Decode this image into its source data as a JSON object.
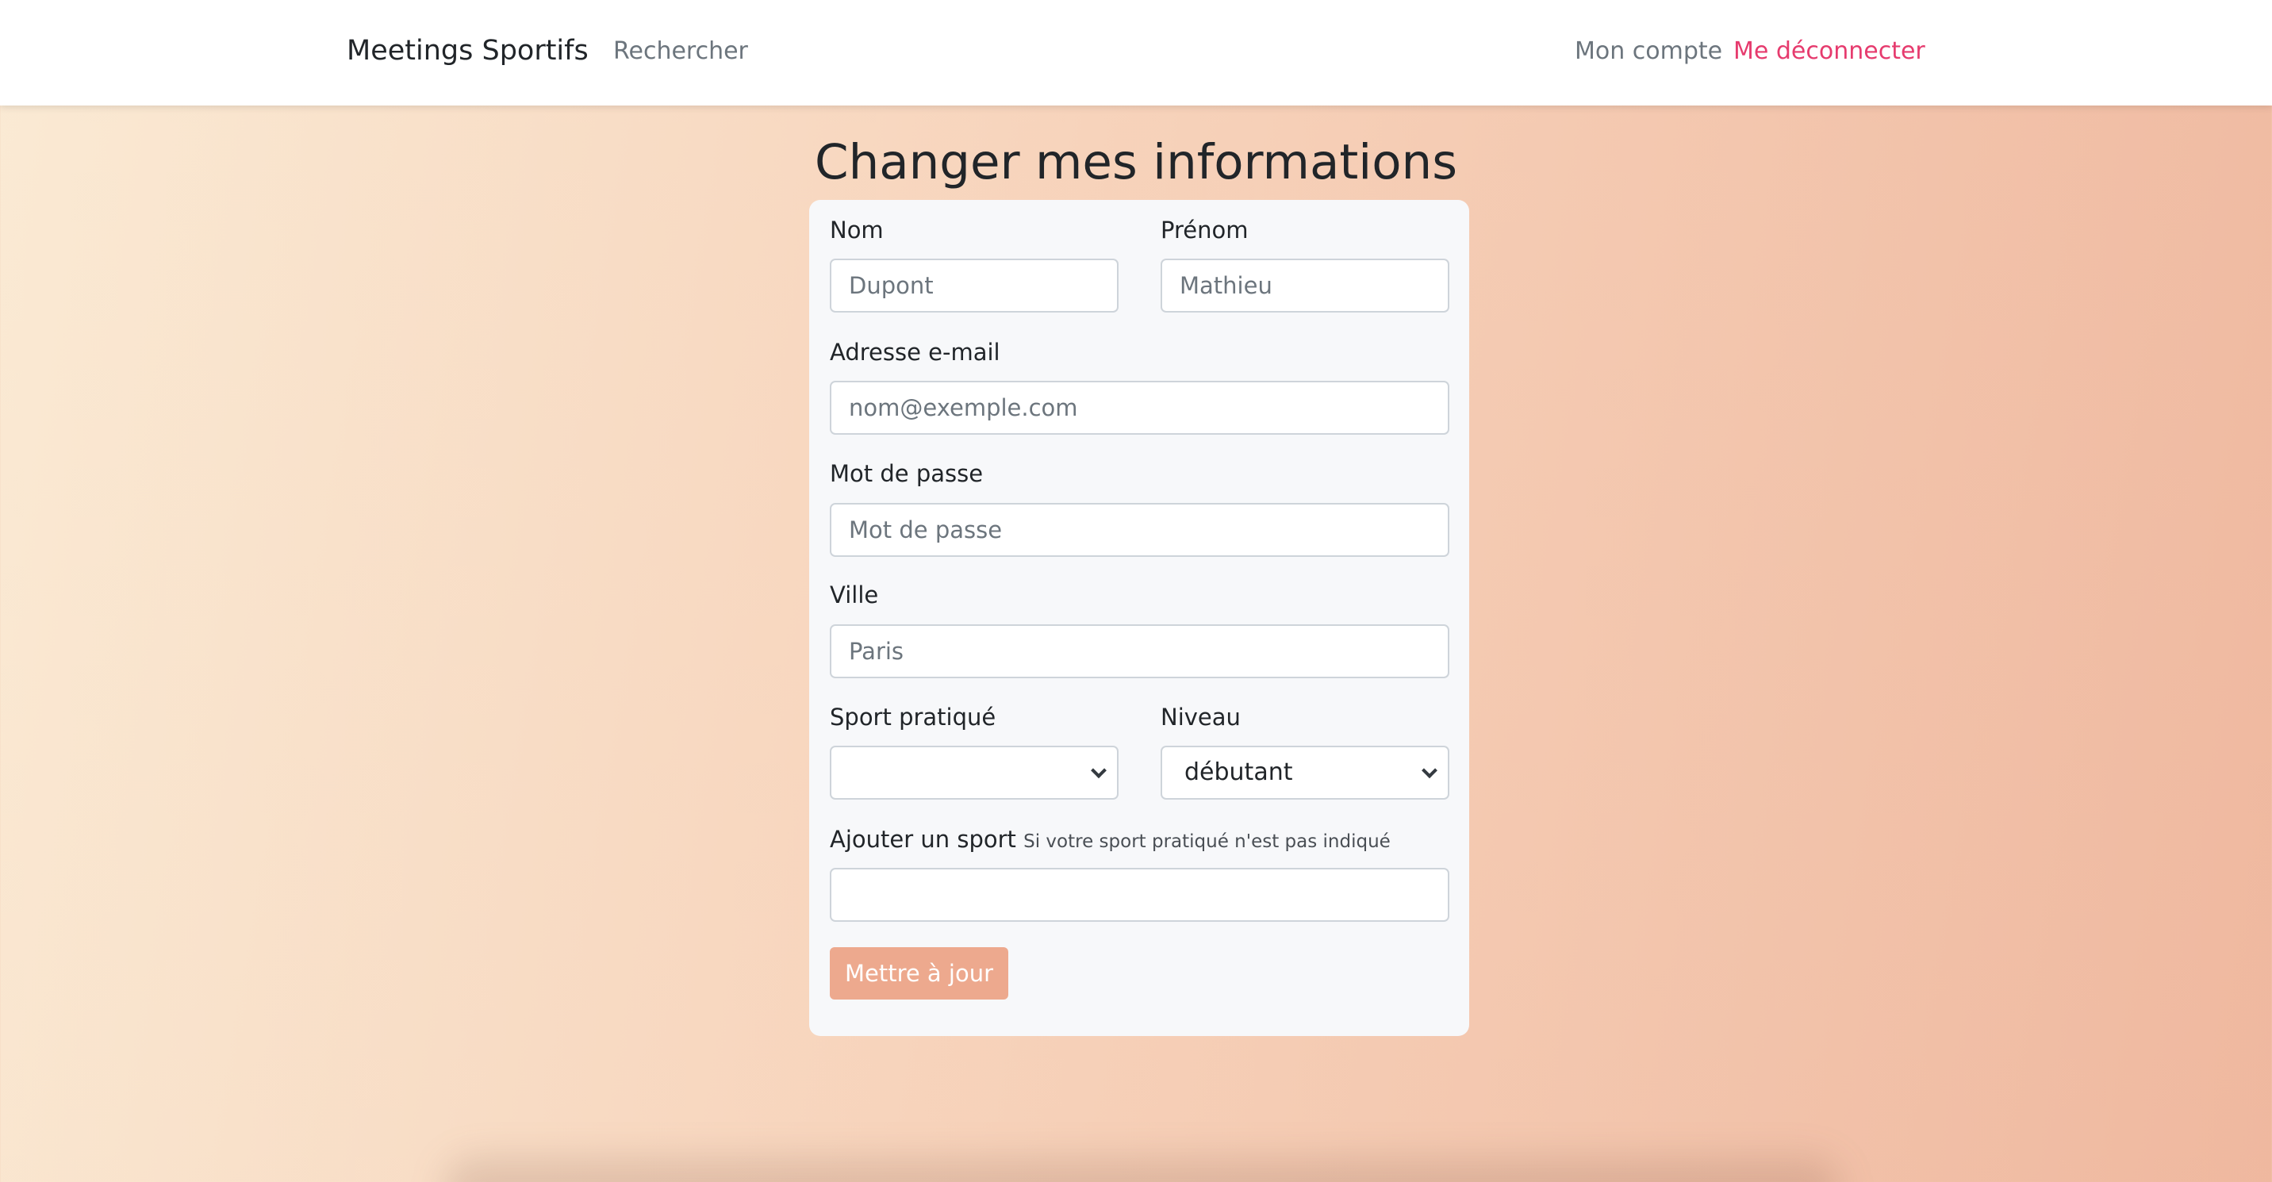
{
  "navbar": {
    "brand": "Meetings Sportifs",
    "search_link": "Rechercher",
    "account_link": "Mon compte",
    "logout_link": "Me déconnecter"
  },
  "page": {
    "title": "Changer mes informations"
  },
  "form": {
    "nom": {
      "label": "Nom",
      "placeholder": "Dupont",
      "value": ""
    },
    "prenom": {
      "label": "Prénom",
      "placeholder": "Mathieu",
      "value": ""
    },
    "email": {
      "label": "Adresse e-mail",
      "placeholder": "nom@exemple.com",
      "value": ""
    },
    "password": {
      "label": "Mot de passe",
      "placeholder": "Mot de passe",
      "value": ""
    },
    "ville": {
      "label": "Ville",
      "placeholder": "Paris",
      "value": ""
    },
    "sport": {
      "label": "Sport pratiqué",
      "selected": ""
    },
    "niveau": {
      "label": "Niveau",
      "selected": "débutant"
    },
    "add_sport": {
      "label": "Ajouter un sport",
      "hint": "Si votre sport pratiqué n'est pas indiqué",
      "value": ""
    },
    "submit_label": "Mettre à jour"
  },
  "colors": {
    "accent": "#e63b6e",
    "button": "#eda98e",
    "card": "#f7f8fa"
  }
}
